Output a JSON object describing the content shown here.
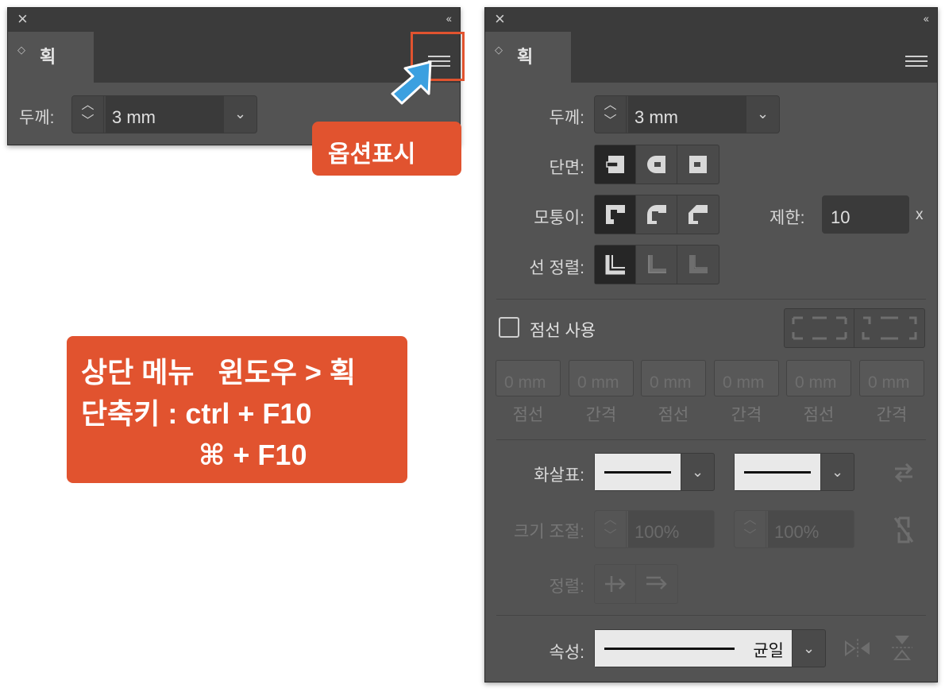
{
  "small_panel": {
    "close_icon": "×",
    "collapse_icon": "‹‹",
    "tab_label": "획",
    "thickness_label": "두께:",
    "thickness_value": "3 mm"
  },
  "callouts": {
    "options_label": "옵션표시",
    "menu_lines": [
      "상단 메뉴   윈도우 > 획",
      "단축키 : ctrl + F10",
      "⌘ + F10"
    ]
  },
  "big_panel": {
    "close_icon": "×",
    "collapse_icon": "‹‹",
    "tab_label": "획",
    "thickness_label": "두께:",
    "thickness_value": "3 mm",
    "cap_label": "단면:",
    "corner_label": "모퉁이:",
    "limit_label": "제한:",
    "limit_value": "10",
    "limit_unit": "x",
    "align_label": "선 정렬:",
    "dashed_label": "점선 사용",
    "dashed_checked": false,
    "dash_fields": [
      {
        "value": "0 mm",
        "label": "점선"
      },
      {
        "value": "0 mm",
        "label": "간격"
      },
      {
        "value": "0 mm",
        "label": "점선"
      },
      {
        "value": "0 mm",
        "label": "간격"
      },
      {
        "value": "0 mm",
        "label": "점선"
      },
      {
        "value": "0 mm",
        "label": "간격"
      }
    ],
    "arrowhead_label": "화살표:",
    "scale_label": "크기 조절:",
    "scale_start": "100%",
    "scale_end": "100%",
    "arrow_align_label": "정렬:",
    "profile_label": "속성:",
    "profile_value": "균일"
  },
  "colors": {
    "panel_bg": "#535353",
    "titlebar_bg": "#3b3b3b",
    "accent": "#e1532f",
    "pointer": "#3ba0e0"
  }
}
